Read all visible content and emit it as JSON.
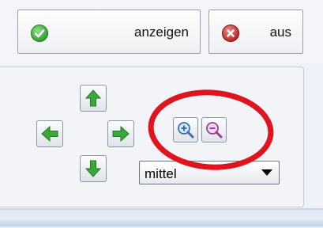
{
  "toolbar": {
    "show_label": "anzeigen",
    "off_label": "aus"
  },
  "navigation": {
    "icons": [
      "arrow-up-icon",
      "arrow-left-icon",
      "arrow-right-icon",
      "arrow-down-icon"
    ],
    "arrow_color": "#3aa83a"
  },
  "zoom": {
    "icons": [
      "zoom-in-icon",
      "zoom-out-icon"
    ]
  },
  "speed_select": {
    "selected": "mittel"
  },
  "annotation": {
    "color": "#e0141e"
  }
}
